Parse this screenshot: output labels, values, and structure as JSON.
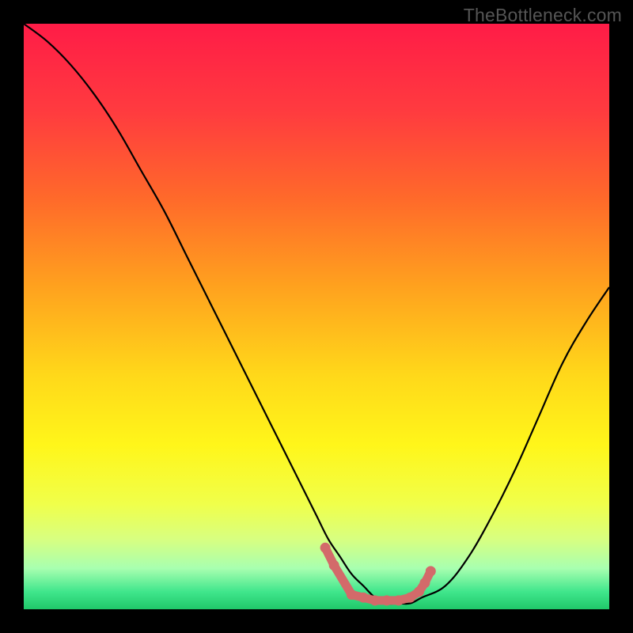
{
  "watermark": "TheBottleneck.com",
  "colors": {
    "gradient_stops": [
      {
        "offset": 0.0,
        "color": "#ff1c47"
      },
      {
        "offset": 0.15,
        "color": "#ff3b3f"
      },
      {
        "offset": 0.3,
        "color": "#ff6a2a"
      },
      {
        "offset": 0.45,
        "color": "#ffa21e"
      },
      {
        "offset": 0.6,
        "color": "#ffd81a"
      },
      {
        "offset": 0.72,
        "color": "#fff61a"
      },
      {
        "offset": 0.82,
        "color": "#f0ff4a"
      },
      {
        "offset": 0.88,
        "color": "#d8ff80"
      },
      {
        "offset": 0.93,
        "color": "#a8ffb0"
      },
      {
        "offset": 0.97,
        "color": "#40e68c"
      },
      {
        "offset": 1.0,
        "color": "#20c86a"
      }
    ],
    "curve": "#000000",
    "markers": "#d36a6a"
  },
  "chart_data": {
    "type": "line",
    "title": "",
    "xlabel": "",
    "ylabel": "",
    "xlim": [
      0,
      100
    ],
    "ylim": [
      0,
      100
    ],
    "series": [
      {
        "name": "bottleneck-curve",
        "x": [
          0,
          4,
          8,
          12,
          16,
          20,
          24,
          28,
          32,
          36,
          40,
          44,
          48,
          50,
          52,
          54,
          56,
          58,
          60,
          62,
          64,
          66,
          68,
          72,
          76,
          80,
          84,
          88,
          92,
          96,
          100
        ],
        "y": [
          100,
          97,
          93,
          88,
          82,
          75,
          68,
          60,
          52,
          44,
          36,
          28,
          20,
          16,
          12,
          9,
          6,
          4,
          2,
          1,
          1,
          1,
          2,
          4,
          9,
          16,
          24,
          33,
          42,
          49,
          55
        ]
      }
    ],
    "markers": {
      "name": "optimal-zone",
      "style": "dots",
      "x": [
        51.5,
        53,
        56,
        58,
        60,
        62,
        64,
        66,
        67.5,
        68.5,
        69.5
      ],
      "y": [
        10.5,
        7.5,
        2.5,
        2.0,
        1.5,
        1.5,
        1.5,
        2.0,
        3.0,
        4.5,
        6.5
      ]
    }
  }
}
